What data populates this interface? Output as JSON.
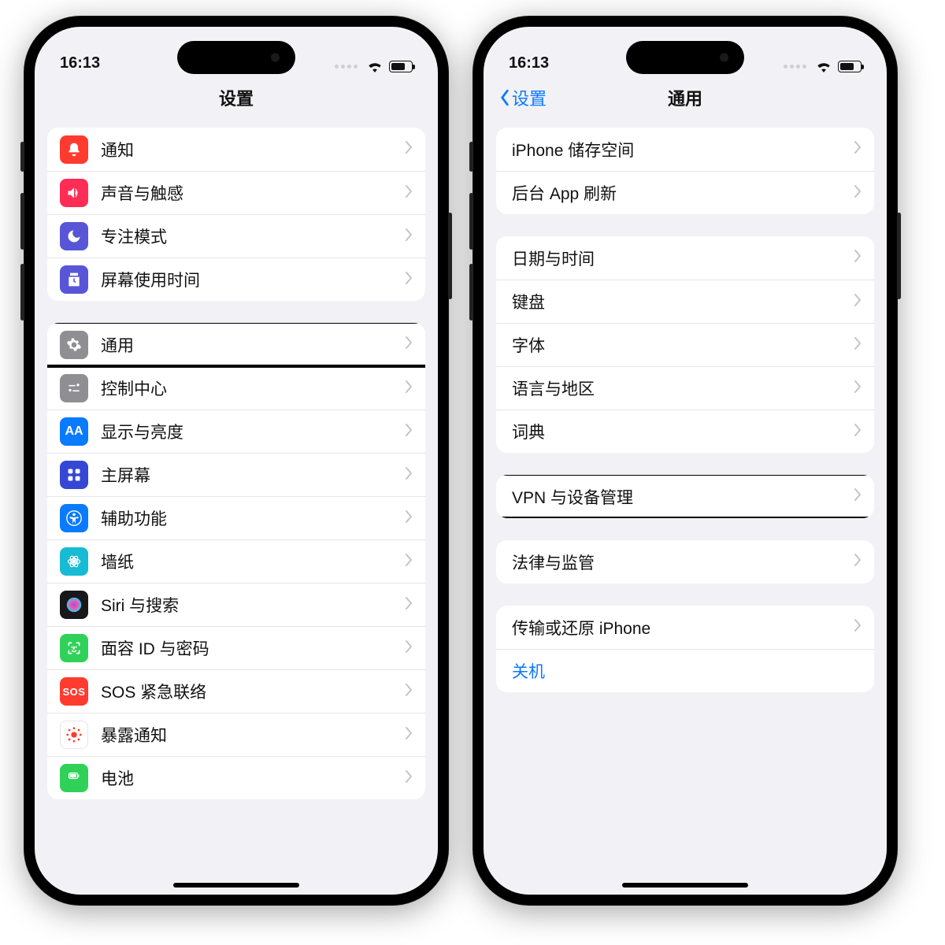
{
  "status": {
    "time": "16:13"
  },
  "left": {
    "title": "设置",
    "group1": [
      {
        "id": "notifications",
        "label": "通知",
        "bg": "#ff3b30"
      },
      {
        "id": "sound",
        "label": "声音与触感",
        "bg": "#ff2d55"
      },
      {
        "id": "focus",
        "label": "专注模式",
        "bg": "#5856d6"
      },
      {
        "id": "screentime",
        "label": "屏幕使用时间",
        "bg": "#5856d6"
      }
    ],
    "group2": [
      {
        "id": "general",
        "label": "通用",
        "bg": "#8e8e93"
      },
      {
        "id": "control-center",
        "label": "控制中心",
        "bg": "#8e8e93"
      },
      {
        "id": "display",
        "label": "显示与亮度",
        "bg": "#0a7aff"
      },
      {
        "id": "home",
        "label": "主屏幕",
        "bg": "#3447d5"
      },
      {
        "id": "accessibility",
        "label": "辅助功能",
        "bg": "#0a7aff"
      },
      {
        "id": "wallpaper",
        "label": "墙纸",
        "bg": "#17bbd4"
      },
      {
        "id": "siri",
        "label": "Siri 与搜索",
        "bg": "#18181a"
      },
      {
        "id": "faceid",
        "label": "面容 ID 与密码",
        "bg": "#30d158"
      },
      {
        "id": "sos",
        "label": "SOS 紧急联络",
        "bg": "#ff3b30"
      },
      {
        "id": "exposure",
        "label": "暴露通知",
        "bg": "#ffffff"
      },
      {
        "id": "battery",
        "label": "电池",
        "bg": "#30d158"
      }
    ]
  },
  "right": {
    "back": "设置",
    "title": "通用",
    "group1": [
      {
        "id": "storage",
        "label": "iPhone 储存空间"
      },
      {
        "id": "bg-refresh",
        "label": "后台 App 刷新"
      }
    ],
    "group2": [
      {
        "id": "datetime",
        "label": "日期与时间"
      },
      {
        "id": "keyboard",
        "label": "键盘"
      },
      {
        "id": "fonts",
        "label": "字体"
      },
      {
        "id": "lang",
        "label": "语言与地区"
      },
      {
        "id": "dict",
        "label": "词典"
      }
    ],
    "group3": [
      {
        "id": "vpn",
        "label": "VPN 与设备管理"
      }
    ],
    "group4": [
      {
        "id": "legal",
        "label": "法律与监管"
      }
    ],
    "group5": [
      {
        "id": "transfer",
        "label": "传输或还原 iPhone"
      },
      {
        "id": "shutdown",
        "label": "关机",
        "special": "blue"
      }
    ]
  }
}
